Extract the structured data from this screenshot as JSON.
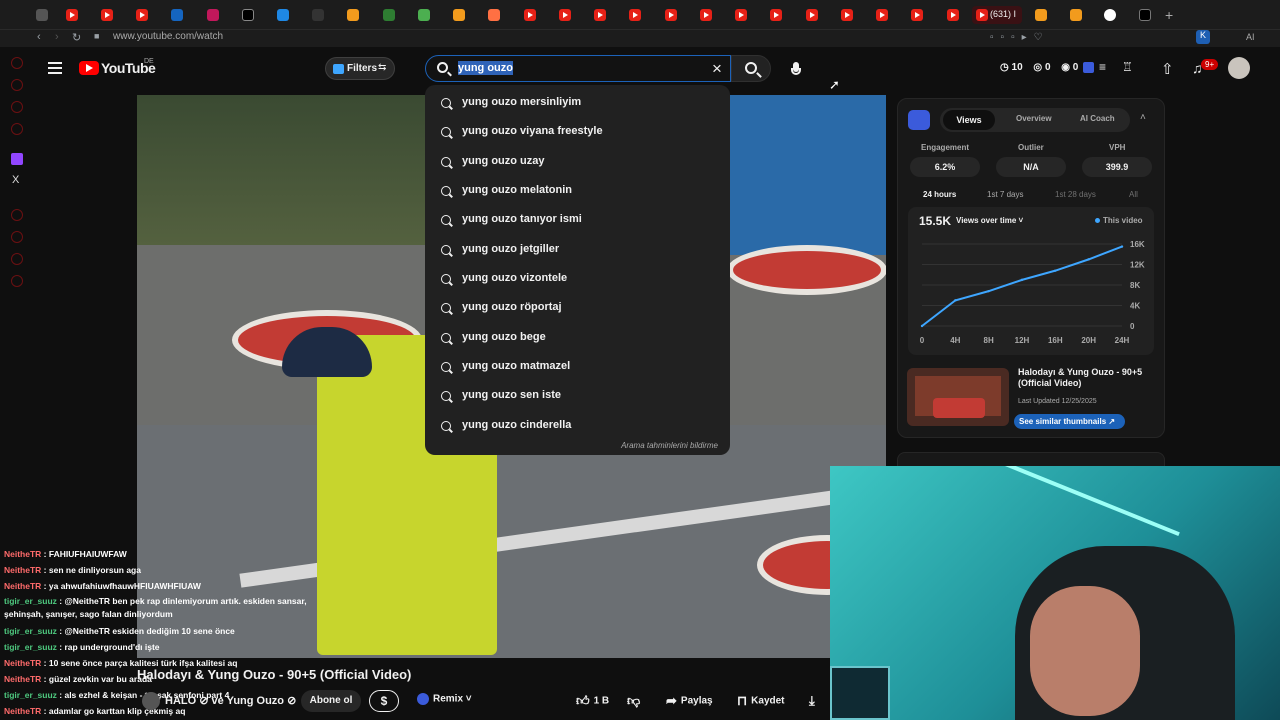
{
  "browser": {
    "url": "www.youtube.com/watch",
    "active_tab_label": "(631) I",
    "extension_label": "AI"
  },
  "header": {
    "logo_text": "YouTube",
    "region": "DE",
    "filters_label": "Filters",
    "search_query": "yung ouzo",
    "stats": {
      "a": "10",
      "b": "0",
      "c": "0"
    },
    "notification_count": "9+"
  },
  "suggestions": {
    "items": [
      "yung ouzo mersinliyim",
      "yung ouzo viyana freestyle",
      "yung ouzo uzay",
      "yung ouzo melatonin",
      "yung ouzo tanıyor ismi",
      "yung ouzo jetgiller",
      "yung ouzo vizontele",
      "yung ouzo röportaj",
      "yung ouzo bege",
      "yung ouzo matmazel",
      "yung ouzo sen iste",
      "yung ouzo cinderella"
    ],
    "footer": "Arama tahminlerini bildirme"
  },
  "panel": {
    "tabs": [
      "Views",
      "Overview",
      "AI Coach"
    ],
    "metrics": [
      {
        "label": "Engagement",
        "value": "6.2%"
      },
      {
        "label": "Outlier",
        "value": "N/A"
      },
      {
        "label": "VPH",
        "value": "399.9"
      }
    ],
    "ranges": [
      "24 hours",
      "1st 7 days",
      "1st 28 days",
      "All"
    ],
    "total": "15.5K",
    "metric_selector": "Views over time",
    "legend": "This video",
    "thumb_title": "Halodayı & Yung Ouzo - 90+5 (Official Video)",
    "thumb_updated": "Last Updated 12/25/2025",
    "similar_label": "See similar thumbnails ↗"
  },
  "chart_data": {
    "type": "line",
    "x": [
      "0",
      "4H",
      "8H",
      "12H",
      "16H",
      "20H",
      "24H"
    ],
    "series": [
      {
        "name": "This video",
        "values": [
          0,
          5000,
          6800,
          9000,
          10800,
          13000,
          15500
        ]
      }
    ],
    "y_ticks": [
      "16K",
      "12K",
      "8K",
      "4K",
      "0"
    ],
    "ylim": [
      0,
      16000
    ],
    "color": "#3ea6ff",
    "grid": true
  },
  "video": {
    "title": "Halodayı & Yung Ouzo - 90+5 (Official Video)",
    "channel": "HALO ⊘ ve Yung Ouzo ⊘",
    "subscribe_label": "Abone ol",
    "donate_label": "$",
    "remix_label": "Remix",
    "like_count": "1 B",
    "share_label": "Paylaş",
    "save_label": "Kaydet"
  },
  "chat": [
    {
      "user": "NeitheTR",
      "msg": "FAHIUFHAIUWFAW",
      "color": "red"
    },
    {
      "user": "NeitheTR",
      "msg": "sen ne dinliyorsun aga",
      "color": "red"
    },
    {
      "user": "NeitheTR",
      "msg": "ya ahwufahiuwfhauwHFIUAWHFIUAW",
      "color": "red"
    },
    {
      "user": "tigir_er_suuz",
      "msg": "@NeitheTR ben pek rap dinlemiyorum artık. eskiden sansar, şehinşah, şanışer, sago falan dinliyordum",
      "color": "green"
    },
    {
      "user": "tigir_er_suuz",
      "msg": "@NeitheTR eskiden dediğim 10 sene önce",
      "color": "green"
    },
    {
      "user": "tigir_er_suuz",
      "msg": "rap underground'dı işte",
      "color": "green"
    },
    {
      "user": "NeitheTR",
      "msg": "10 sene önce parça kalitesi türk ifşa kalitesi aq",
      "color": "red"
    },
    {
      "user": "NeitheTR",
      "msg": "güzel zevkin var bu arada",
      "color": "red"
    },
    {
      "user": "tigir_er_suuz",
      "msg": "als ezhel & keişan - taşşak senfoni part 4",
      "color": "green"
    },
    {
      "user": "NeitheTR",
      "msg": "adamlar go karttan klip çekmiş aq",
      "color": "red"
    }
  ]
}
